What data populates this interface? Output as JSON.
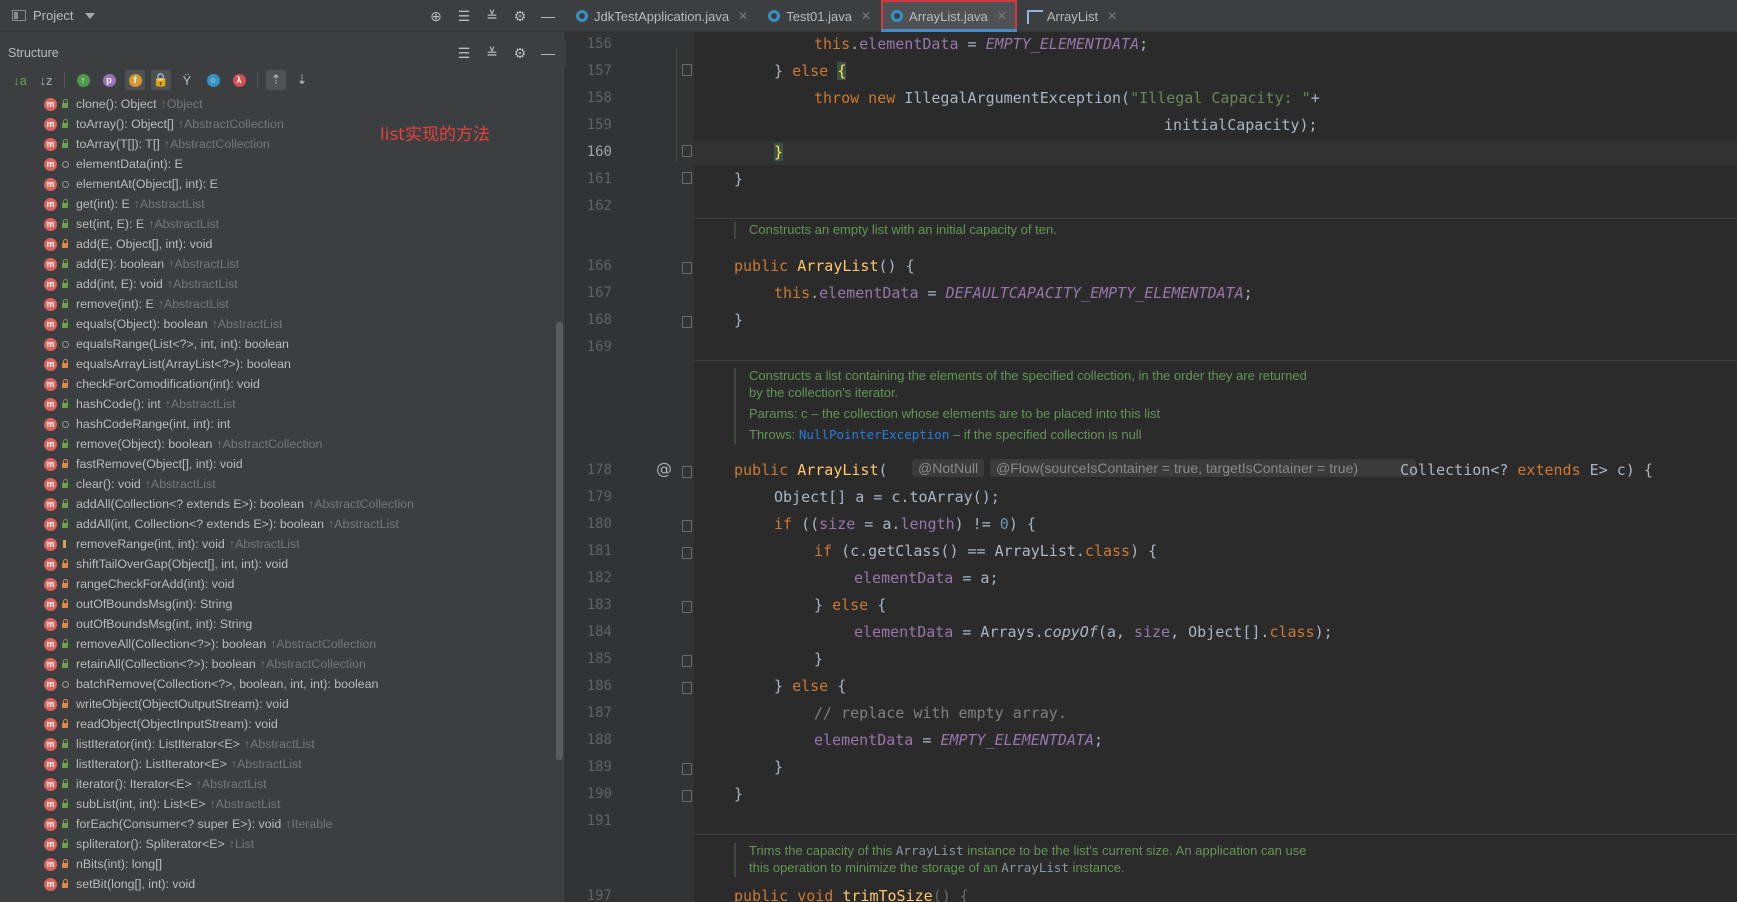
{
  "project_bar": {
    "label": "Project"
  },
  "structure": {
    "title": "Structure",
    "items": [
      {
        "sig": "clone(): Object",
        "origin": "↑Object",
        "vis": "public"
      },
      {
        "sig": "toArray(): Object[]",
        "origin": "↑AbstractCollection",
        "vis": "public"
      },
      {
        "sig": "toArray(T[]): T[]",
        "origin": "↑AbstractCollection",
        "vis": "public"
      },
      {
        "sig": "elementData(int): E",
        "origin": "",
        "vis": "package"
      },
      {
        "sig": "elementAt(Object[], int): E",
        "origin": "",
        "vis": "package"
      },
      {
        "sig": "get(int): E",
        "origin": "↑AbstractList",
        "vis": "public"
      },
      {
        "sig": "set(int, E): E",
        "origin": "↑AbstractList",
        "vis": "public"
      },
      {
        "sig": "add(E, Object[], int): void",
        "origin": "",
        "vis": "private"
      },
      {
        "sig": "add(E): boolean",
        "origin": "↑AbstractList",
        "vis": "public"
      },
      {
        "sig": "add(int, E): void",
        "origin": "↑AbstractList",
        "vis": "public"
      },
      {
        "sig": "remove(int): E",
        "origin": "↑AbstractList",
        "vis": "public"
      },
      {
        "sig": "equals(Object): boolean",
        "origin": "↑AbstractList",
        "vis": "public"
      },
      {
        "sig": "equalsRange(List<?>, int, int): boolean",
        "origin": "",
        "vis": "package"
      },
      {
        "sig": "equalsArrayList(ArrayList<?>): boolean",
        "origin": "",
        "vis": "private"
      },
      {
        "sig": "checkForComodification(int): void",
        "origin": "",
        "vis": "private"
      },
      {
        "sig": "hashCode(): int",
        "origin": "↑AbstractList",
        "vis": "public"
      },
      {
        "sig": "hashCodeRange(int, int): int",
        "origin": "",
        "vis": "package"
      },
      {
        "sig": "remove(Object): boolean",
        "origin": "↑AbstractCollection",
        "vis": "public"
      },
      {
        "sig": "fastRemove(Object[], int): void",
        "origin": "",
        "vis": "private"
      },
      {
        "sig": "clear(): void",
        "origin": "↑AbstractList",
        "vis": "public"
      },
      {
        "sig": "addAll(Collection<? extends E>): boolean",
        "origin": "↑AbstractCollection",
        "vis": "public"
      },
      {
        "sig": "addAll(int, Collection<? extends E>): boolean",
        "origin": "↑AbstractList",
        "vis": "public"
      },
      {
        "sig": "removeRange(int, int): void",
        "origin": "↑AbstractList",
        "vis": "protected"
      },
      {
        "sig": "shiftTailOverGap(Object[], int, int): void",
        "origin": "",
        "vis": "private"
      },
      {
        "sig": "rangeCheckForAdd(int): void",
        "origin": "",
        "vis": "private"
      },
      {
        "sig": "outOfBoundsMsg(int): String",
        "origin": "",
        "vis": "private"
      },
      {
        "sig": "outOfBoundsMsg(int, int): String",
        "origin": "",
        "vis": "private"
      },
      {
        "sig": "removeAll(Collection<?>): boolean",
        "origin": "↑AbstractCollection",
        "vis": "public"
      },
      {
        "sig": "retainAll(Collection<?>): boolean",
        "origin": "↑AbstractCollection",
        "vis": "public"
      },
      {
        "sig": "batchRemove(Collection<?>, boolean, int, int): boolean",
        "origin": "",
        "vis": "package"
      },
      {
        "sig": "writeObject(ObjectOutputStream): void",
        "origin": "",
        "vis": "private"
      },
      {
        "sig": "readObject(ObjectInputStream): void",
        "origin": "",
        "vis": "private"
      },
      {
        "sig": "listIterator(int): ListIterator<E>",
        "origin": "↑AbstractList",
        "vis": "public"
      },
      {
        "sig": "listIterator(): ListIterator<E>",
        "origin": "↑AbstractList",
        "vis": "public"
      },
      {
        "sig": "iterator(): Iterator<E>",
        "origin": "↑AbstractList",
        "vis": "public"
      },
      {
        "sig": "subList(int, int): List<E>",
        "origin": "↑AbstractList",
        "vis": "public"
      },
      {
        "sig": "forEach(Consumer<? super E>): void",
        "origin": "↑Iterable",
        "vis": "public"
      },
      {
        "sig": "spliterator(): Spliterator<E>",
        "origin": "↑List",
        "vis": "public"
      },
      {
        "sig": "nBits(int): long[]",
        "origin": "",
        "vis": "private"
      },
      {
        "sig": "setBit(long[], int): void",
        "origin": "",
        "vis": "private"
      }
    ]
  },
  "annotation_text": "list实现的方法",
  "tabs": [
    {
      "label": "JdkTestApplication.java",
      "active": false
    },
    {
      "label": "Test01.java",
      "active": false
    },
    {
      "label": "ArrayList.java",
      "active": true
    },
    {
      "label": "ArrayList",
      "active": false
    }
  ],
  "line_numbers": [
    "156",
    "157",
    "158",
    "159",
    "160",
    "161",
    "162",
    "166",
    "167",
    "168",
    "169",
    "178",
    "179",
    "180",
    "181",
    "182",
    "183",
    "184",
    "185",
    "186",
    "187",
    "188",
    "189",
    "190",
    "191",
    "197"
  ],
  "docs": {
    "doc1": "Constructs an empty list with an initial capacity of ten.",
    "doc2_l1": "Constructs a list containing the elements of the specified collection, in the order they are returned",
    "doc2_l2": "by the collection's iterator.",
    "doc2_params": "Params: c – the collection whose elements are to be placed into this list",
    "doc2_throws_label": "Throws: ",
    "doc2_throws_link": "NullPointerException",
    "doc2_throws_rest": " – if the specified collection is null",
    "doc3_a": "Trims the capacity of this ",
    "doc3_code1": "ArrayList",
    "doc3_b": " instance to be the list's current size. An application can use",
    "doc3_c": "this operation to minimize the storage of an ",
    "doc3_code2": "ArrayList",
    "doc3_d": " instance."
  },
  "inlay": {
    "notnull": "@NotNull",
    "flow": "@Flow(sourceIsContainer = true, targetIsContainer = true)"
  },
  "gutter_marker": "@"
}
